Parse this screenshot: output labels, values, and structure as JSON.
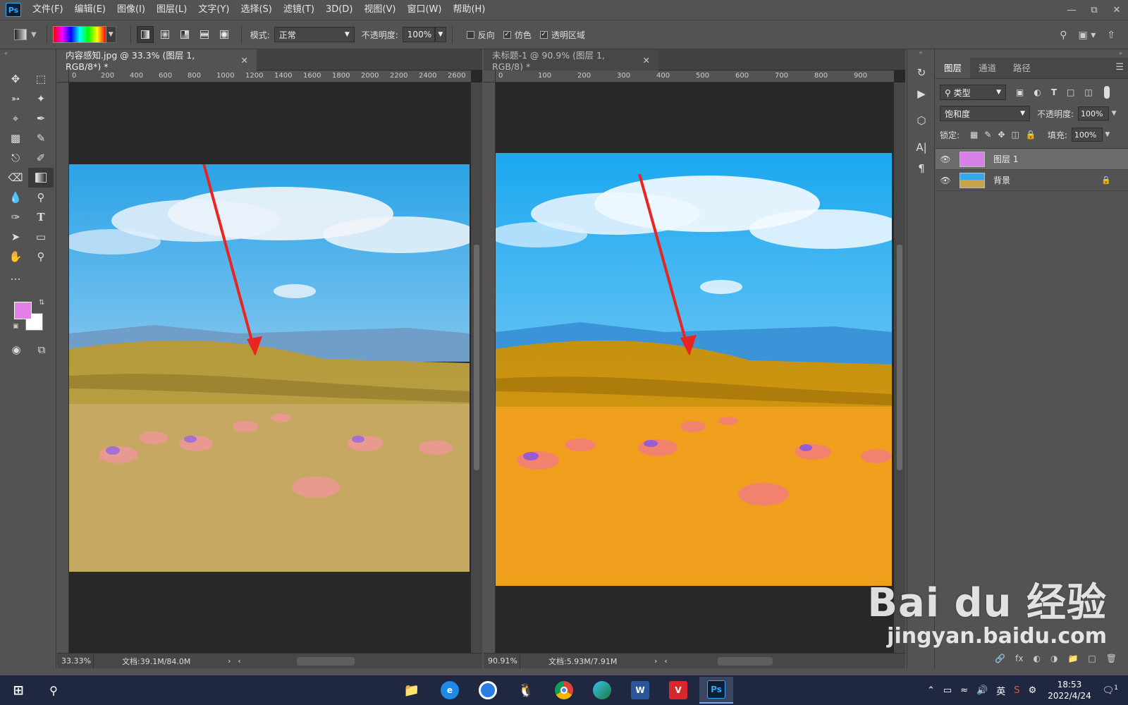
{
  "app": {
    "logo": "Ps"
  },
  "menu": [
    "文件(F)",
    "编辑(E)",
    "图像(I)",
    "图层(L)",
    "文字(Y)",
    "选择(S)",
    "滤镜(T)",
    "3D(D)",
    "视图(V)",
    "窗口(W)",
    "帮助(H)"
  ],
  "options": {
    "mode_label": "模式:",
    "mode_value": "正常",
    "opacity_label": "不透明度:",
    "opacity_value": "100%",
    "reverse_label": "反向",
    "dither_label": "仿色",
    "transparency_label": "透明区域"
  },
  "doc1": {
    "tab": "内容感知.jpg @ 33.3% (图层 1, RGB/8*) *",
    "ruler": [
      "0",
      "200",
      "400",
      "600",
      "800",
      "1000",
      "1200",
      "1400",
      "1600",
      "1800",
      "2000",
      "2200",
      "2400",
      "2600"
    ],
    "zoom": "33.33%",
    "docsize": "文档:39.1M/84.0M"
  },
  "doc2": {
    "tab": "未标题-1 @ 90.9% (图层 1, RGB/8) *",
    "ruler": [
      "0",
      "100",
      "200",
      "300",
      "400",
      "500",
      "600",
      "700",
      "800",
      "900"
    ],
    "zoom": "90.91%",
    "docsize": "文档:5.93M/7.91M"
  },
  "layers": {
    "tabs": [
      "图层",
      "通道",
      "路径"
    ],
    "filter_value": "类型",
    "blend_value": "饱和度",
    "opacity_label": "不透明度:",
    "opacity_value": "100%",
    "lock_label": "锁定:",
    "fill_label": "填充:",
    "fill_value": "100%",
    "items": [
      {
        "name": "图层 1",
        "color": "#d882e8"
      },
      {
        "name": "背景"
      }
    ]
  },
  "colors": {
    "foreground": "#e47ee8",
    "background": "#ffffff"
  },
  "taskbar": {
    "ime": "英",
    "time": "18:53",
    "date": "2022/4/24",
    "notif": "1"
  },
  "watermark": {
    "main": "Bai du 经验",
    "sub": "jingyan.baidu.com"
  }
}
